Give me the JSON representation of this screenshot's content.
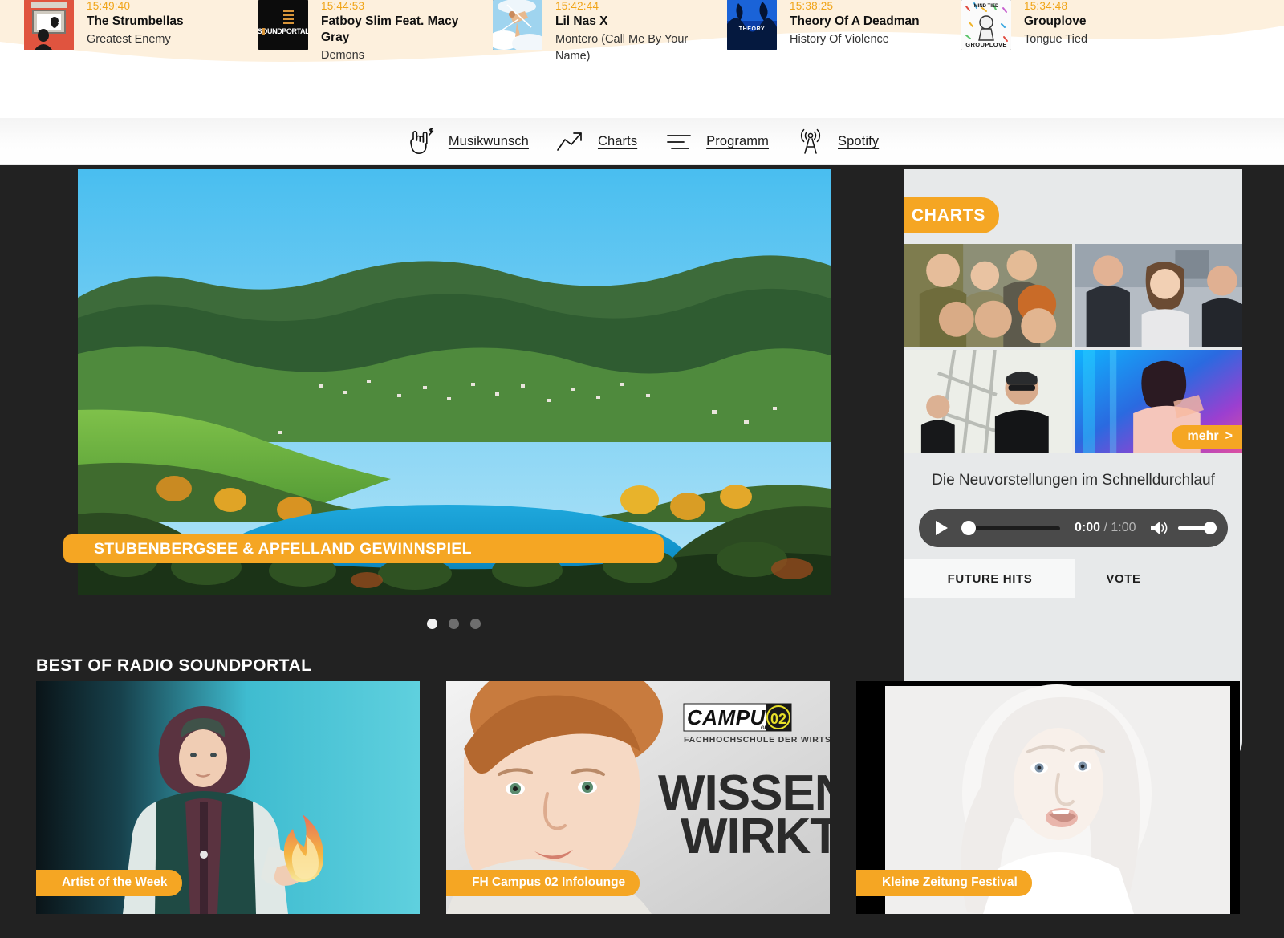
{
  "brand": {
    "orange": "#f5a623",
    "dark": "#222222",
    "panel_bg": "#e7e9ea"
  },
  "ticker": {
    "name": "now-playing-ticker",
    "items": [
      {
        "time": "15:49:40",
        "artist": "The Strumbellas",
        "title": "Greatest Enemy",
        "art": "strumbellas"
      },
      {
        "time": "15:44:53",
        "artist": "Fatboy Slim Feat. Macy Gray",
        "title": "Demons",
        "art": "soundportal"
      },
      {
        "time": "15:42:44",
        "artist": "Lil Nas X",
        "title": "Montero (Call Me By Your Name)",
        "art": "montero"
      },
      {
        "time": "15:38:25",
        "artist": "Theory Of A Deadman",
        "title": "History Of Violence",
        "art": "theory"
      },
      {
        "time": "15:34:48",
        "artist": "Grouplove",
        "title": "Tongue Tied",
        "art": "grouplove"
      }
    ]
  },
  "nav": {
    "items": [
      {
        "icon": "rock-hand-icon",
        "label": "Musikwunsch"
      },
      {
        "icon": "trending-arrow-icon",
        "label": "Charts"
      },
      {
        "icon": "list-lines-icon",
        "label": "Programm"
      },
      {
        "icon": "radio-tower-icon",
        "label": "Spotify"
      }
    ]
  },
  "hero": {
    "caption": "STUBENBERGSEE & APFELLAND GEWINNSPIEL",
    "slides_total": 3,
    "active_slide": 1
  },
  "charts": {
    "badge": "CHARTS",
    "more_label": "mehr",
    "more_chevron": ">",
    "description": "Die Neuvorstellungen im Schnelldurchlauf",
    "player": {
      "current_time": "0:00",
      "separator": "/",
      "duration": "1:00",
      "progress_percent": 3,
      "volume_percent": 100
    },
    "tabs": [
      {
        "label": "FUTURE HITS",
        "active": true
      },
      {
        "label": "VOTE",
        "active": false
      }
    ]
  },
  "bestof": {
    "title": "BEST OF RADIO SOUNDPORTAL",
    "cards": [
      {
        "tag": "Artist of the Week",
        "art": "artist-fire"
      },
      {
        "tag": "FH Campus 02 Infolounge",
        "art": "campus02"
      },
      {
        "tag": "Kleine Zeitung Festival",
        "art": "kleine-zeitung"
      }
    ]
  },
  "campus_ad": {
    "logo_word": "CAMPUS",
    "logo_sub": "GRAZ",
    "logo_number": "02",
    "logo_tagline": "FACHHOCHSCHULE DER WIRTSCHAFT",
    "headline_line1": "WISSEN",
    "headline_line2": "WIRKT."
  },
  "soundportal_logo": {
    "wordmark": "SOUNDPORTAL"
  }
}
